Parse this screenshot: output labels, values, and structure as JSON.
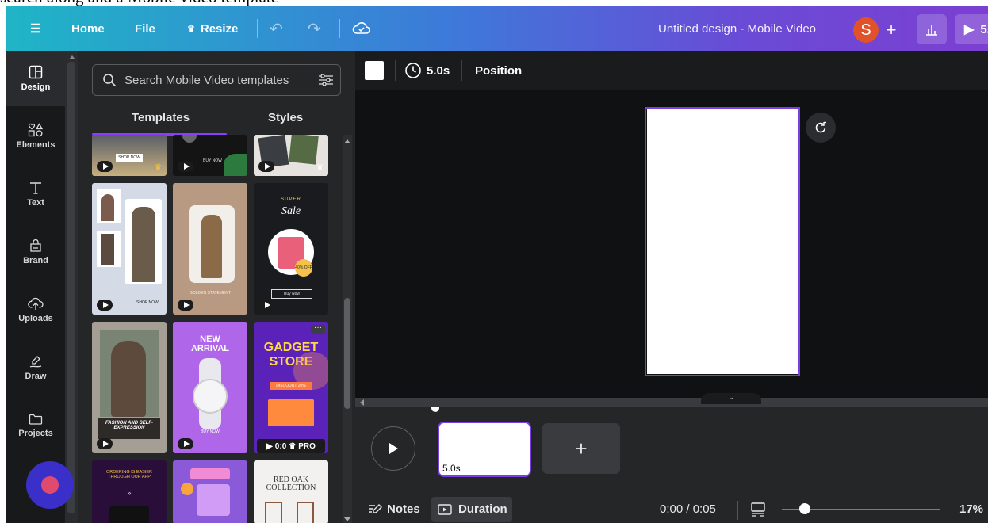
{
  "top_clipped_text": "search along and a Mobile video template",
  "topbar": {
    "home": "Home",
    "file": "File",
    "resize": "Resize",
    "doc_title": "Untitled design - Mobile Video",
    "avatar_initial": "S",
    "present_label": "5."
  },
  "rail": [
    {
      "label": "Design"
    },
    {
      "label": "Elements"
    },
    {
      "label": "Text"
    },
    {
      "label": "Brand"
    },
    {
      "label": "Uploads"
    },
    {
      "label": "Draw"
    },
    {
      "label": "Projects"
    }
  ],
  "panel": {
    "search_placeholder": "Search Mobile Video templates",
    "tabs": [
      "Templates",
      "Styles"
    ],
    "tiles": {
      "shop_now": "SHOP NOW",
      "buy_now": "BUY NOW",
      "super": "SUPER",
      "sale": "Sale",
      "discount_badge": "40% OFF",
      "golden": "GOLDEN STATEMENT",
      "buy_now_small": "Buy Now",
      "new": "NEW",
      "arrival": "ARRIVAL",
      "gadget": "GADGET",
      "store": "STORE",
      "discount": "DISCOUNT 20%",
      "fashion": "FASHION AND SELF-EXPRESSION",
      "pro_time": "0:0",
      "pro": "PRO",
      "ordering": "ORDERING IS EASIER THROUGH OUR APP",
      "red_oak": "RED OAK COLLECTION"
    }
  },
  "canvas_toolbar": {
    "duration": "5.0s",
    "position": "Position"
  },
  "timeline": {
    "scene_duration": "5.0s",
    "notes": "Notes",
    "duration_btn": "Duration",
    "time": "0:00 / 0:05",
    "zoom": "17%"
  },
  "colors": {
    "accent_purple": "#7a3fe0",
    "panel_dark": "#252627",
    "workspace": "#0f1113"
  }
}
